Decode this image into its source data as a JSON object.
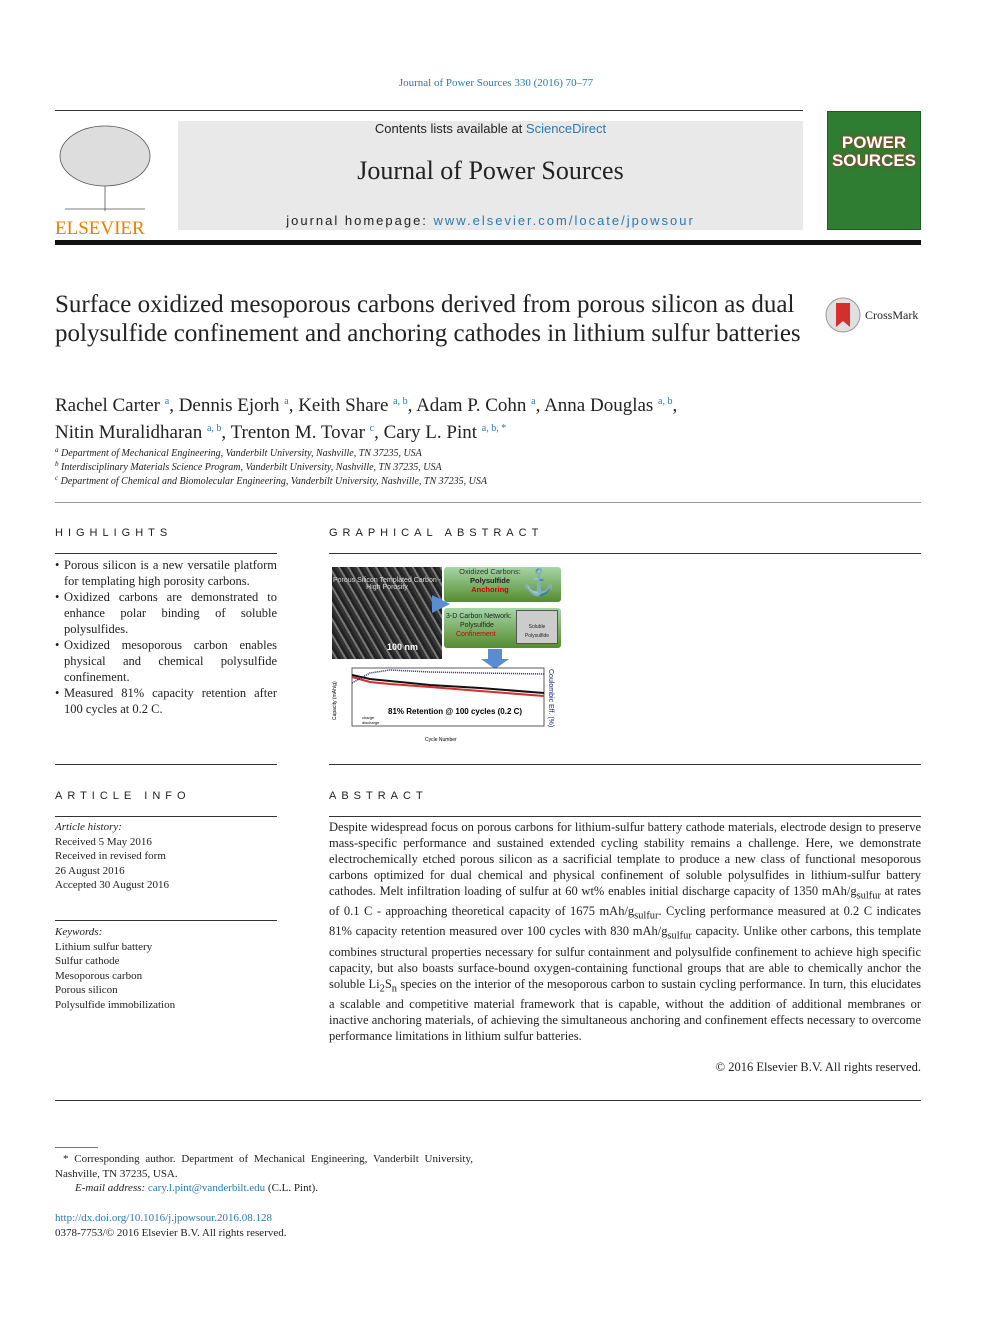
{
  "journal_ref": "Journal of Power Sources 330 (2016) 70–77",
  "header": {
    "contents_prefix": "Contents lists available at ",
    "contents_link": "ScienceDirect",
    "journal_title": "Journal of Power Sources",
    "homepage_prefix": "journal homepage: ",
    "homepage_link": "www.elsevier.com/locate/jpowsour",
    "publisher_logo": "ELSEVIER",
    "cover_text": "POWER SOURCES"
  },
  "crossmark": "CrossMark",
  "title": "Surface oxidized mesoporous carbons derived from porous silicon as dual polysulfide confinement and anchoring cathodes in lithium sulfur batteries",
  "authors": [
    {
      "name": "Rachel Carter",
      "sup": "a"
    },
    {
      "name": "Dennis Ejorh",
      "sup": "a"
    },
    {
      "name": "Keith Share",
      "sup": "a, b"
    },
    {
      "name": "Adam P. Cohn",
      "sup": "a"
    },
    {
      "name": "Anna Douglas",
      "sup": "a, b"
    },
    {
      "name": "Nitin Muralidharan",
      "sup": "a, b"
    },
    {
      "name": "Trenton M. Tovar",
      "sup": "c"
    },
    {
      "name": "Cary L. Pint",
      "sup": "a, b, *"
    }
  ],
  "affiliations": [
    {
      "key": "a",
      "text": "Department of Mechanical Engineering, Vanderbilt University, Nashville, TN 37235, USA"
    },
    {
      "key": "b",
      "text": "Interdisciplinary Materials Science Program, Vanderbilt University, Nashville, TN 37235, USA"
    },
    {
      "key": "c",
      "text": "Department of Chemical and Biomolecular Engineering, Vanderbilt University, Nashville, TN 37235, USA"
    }
  ],
  "highlights": {
    "heading": "HIGHLIGHTS",
    "items": [
      "Porous silicon is a new versatile platform for templating high porosity carbons.",
      "Oxidized carbons are demonstrated to enhance polar binding of soluble polysulfides.",
      "Oxidized mesoporous carbon enables physical and chemical polysulfide confinement.",
      "Measured 81% capacity retention after 100 cycles at 0.2 C."
    ]
  },
  "graphical_abstract": {
    "heading": "GRAPHICAL ABSTRACT",
    "sem_label": "Porous Silicon Templated Carbon - High Porosity",
    "scale": "100 nm",
    "box1_line1": "Oxidized Carbons:",
    "box1_line2": "Polysulfide",
    "box1_line3": "Anchoring",
    "box2_line1": "3-D Carbon Network:",
    "box2_line2": "Polysulfide",
    "box2_line3": "Confinement",
    "cage_label": "Soluble Polysulfide",
    "plot_label": "81% Retention @ 100 cycles (0.2 C)",
    "xlabel": "Cycle Number",
    "ylabel": "Capacity (mAh/g)",
    "y2label": "Coulombic Eff. (%)",
    "legend": [
      "charge",
      "discharge"
    ]
  },
  "article_info": {
    "heading": "ARTICLE INFO",
    "history_label": "Article history:",
    "history": [
      "Received 5 May 2016",
      "Received in revised form",
      "26 August 2016",
      "Accepted 30 August 2016"
    ],
    "keywords_label": "Keywords:",
    "keywords": [
      "Lithium sulfur battery",
      "Sulfur cathode",
      "Mesoporous carbon",
      "Porous silicon",
      "Polysulfide immobilization"
    ]
  },
  "abstract": {
    "heading": "ABSTRACT",
    "p1": "Despite widespread focus on porous carbons for lithium-sulfur battery cathode materials, electrode design to preserve mass-specific performance and sustained extended cycling stability remains a challenge. Here, we demonstrate electrochemically etched porous silicon as a sacrificial template to produce a new class of functional mesoporous carbons optimized for dual chemical and physical confinement of soluble polysulfides in lithium-sulfur battery cathodes. Melt infiltration loading of sulfur at 60 wt% enables initial discharge capacity of 1350 mAh/g",
    "sub": "sulfur",
    "p2": " at rates of 0.1 C - approaching theoretical capacity of 1675 mAh/g",
    "p3": ". Cycling performance measured at 0.2 C indicates 81% capacity retention measured over 100 cycles with 830 mAh/g",
    "p4": " capacity. Unlike other carbons, this template combines structural properties necessary for sulfur containment and polysulfide confinement to achieve high specific capacity, but also boasts surface-bound oxygen-containing functional groups that are able to chemically anchor the soluble Li",
    "sub2": "2",
    "p5": "S",
    "sub3": "n",
    "p6": " species on the interior of the mesoporous carbon to sustain cycling performance. In turn, this elucidates a scalable and competitive material framework that is capable, without the addition of additional membranes or inactive anchoring materials, of achieving the simultaneous anchoring and confinement effects necessary to overcome performance limitations in lithium sulfur batteries.",
    "copyright": "© 2016 Elsevier B.V. All rights reserved."
  },
  "footnote": {
    "star": "*",
    "text": "Corresponding author. Department of Mechanical Engineering, Vanderbilt University, Nashville, TN 37235, USA.",
    "email_label": "E-mail address:",
    "email": "cary.l.pint@vanderbilt.edu",
    "email_suffix": "(C.L. Pint)."
  },
  "doi": "http://dx.doi.org/10.1016/j.jpowsour.2016.08.128",
  "issn": "0378-7753/© 2016 Elsevier B.V. All rights reserved.",
  "colors": {
    "link": "#2a7ab0",
    "cover": "#2e7d32",
    "elsevier": "#f07c00"
  }
}
